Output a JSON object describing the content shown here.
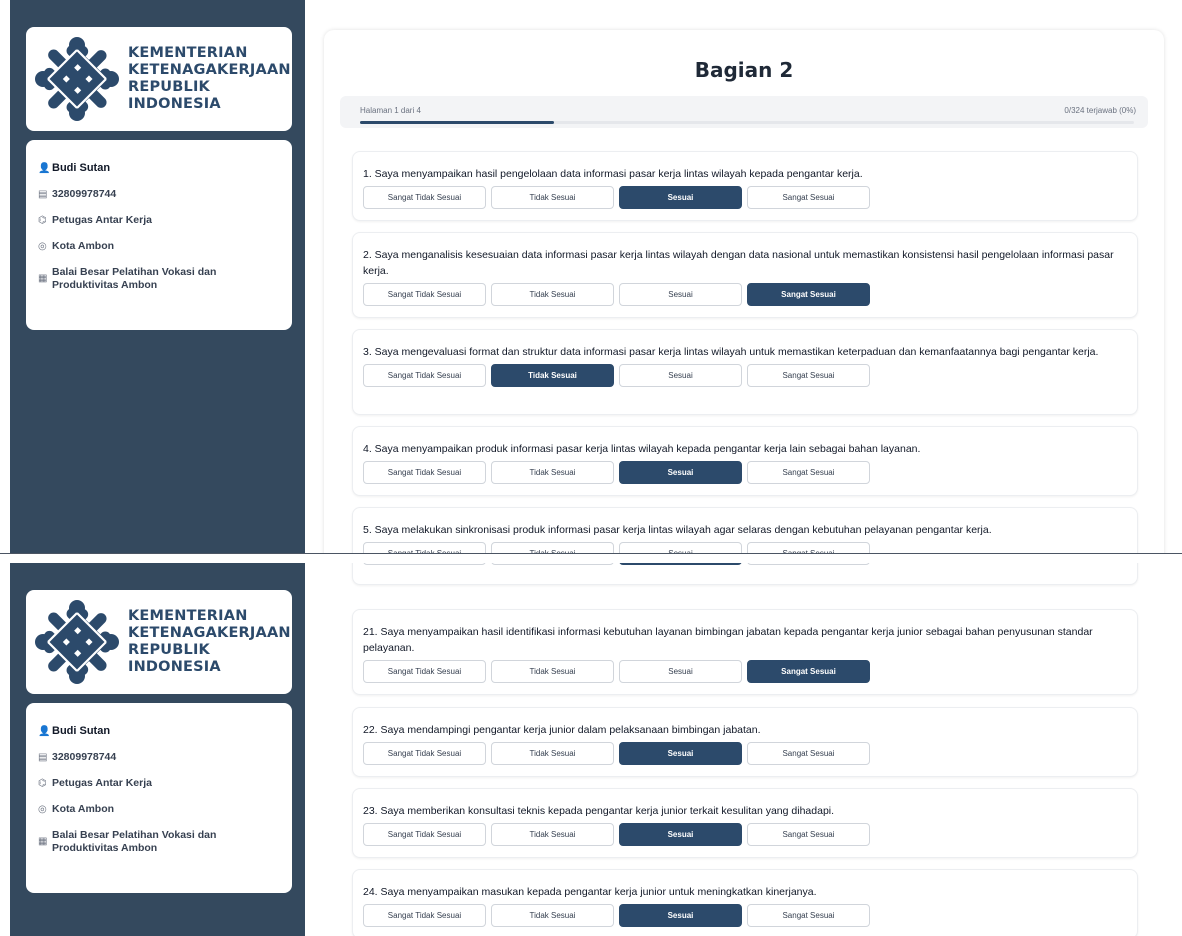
{
  "logo": {
    "lines": [
      "KEMENTERIAN",
      "KETENAGAKERJAAN",
      "REPUBLIK INDONESIA"
    ],
    "color": "#2c4a6b"
  },
  "profile": {
    "name": "Budi Sutan",
    "id_number": "32809978744",
    "role": "Petugas Antar Kerja",
    "city": "Kota Ambon",
    "institution": "Balai Besar Pelatihan Vokasi dan Produktivitas Ambon"
  },
  "survey": {
    "title": "Bagian 2",
    "page_info": "Halaman 1 dari 4",
    "answered_info": "0/324 terjawab (0%)",
    "page_progress_fraction": 0.25
  },
  "options": [
    "Sangat Tidak Sesuai",
    "Tidak Sesuai",
    "Sesuai",
    "Sangat Sesuai"
  ],
  "questions_top": [
    {
      "text": "1. Saya menyampaikan hasil pengelolaan data informasi pasar kerja lintas wilayah kepada pengantar kerja.",
      "selected": "Sesuai"
    },
    {
      "text": "2. Saya menganalisis kesesuaian data informasi pasar kerja lintas wilayah dengan data nasional untuk memastikan konsistensi hasil pengelolaan informasi pasar kerja.",
      "selected": "Sangat Sesuai"
    },
    {
      "text": "3. Saya mengevaluasi format dan struktur data informasi pasar kerja lintas wilayah untuk memastikan keterpaduan dan kemanfaatannya bagi pengantar kerja.",
      "selected": "Tidak Sesuai"
    },
    {
      "text": "4. Saya menyampaikan produk informasi pasar kerja lintas wilayah kepada pengantar kerja lain sebagai bahan layanan.",
      "selected": "Sesuai"
    },
    {
      "text": "5. Saya melakukan sinkronisasi produk informasi pasar kerja lintas wilayah agar selaras dengan kebutuhan pelayanan pengantar kerja.",
      "selected": ""
    }
  ],
  "questions_bottom": [
    {
      "text": "",
      "selected": "Sesuai"
    },
    {
      "text": "21. Saya menyampaikan hasil identifikasi informasi kebutuhan layanan bimbingan jabatan kepada pengantar kerja junior sebagai bahan penyusunan standar pelayanan.",
      "selected": "Sangat Sesuai"
    },
    {
      "text": "22. Saya mendampingi pengantar kerja junior dalam pelaksanaan bimbingan jabatan.",
      "selected": "Sesuai"
    },
    {
      "text": "23. Saya memberikan konsultasi teknis kepada pengantar kerja junior terkait kesulitan yang dihadapi.",
      "selected": "Sesuai"
    },
    {
      "text": "24. Saya menyampaikan masukan kepada pengantar kerja junior untuk meningkatkan kinerjanya.",
      "selected": "Sesuai"
    }
  ]
}
